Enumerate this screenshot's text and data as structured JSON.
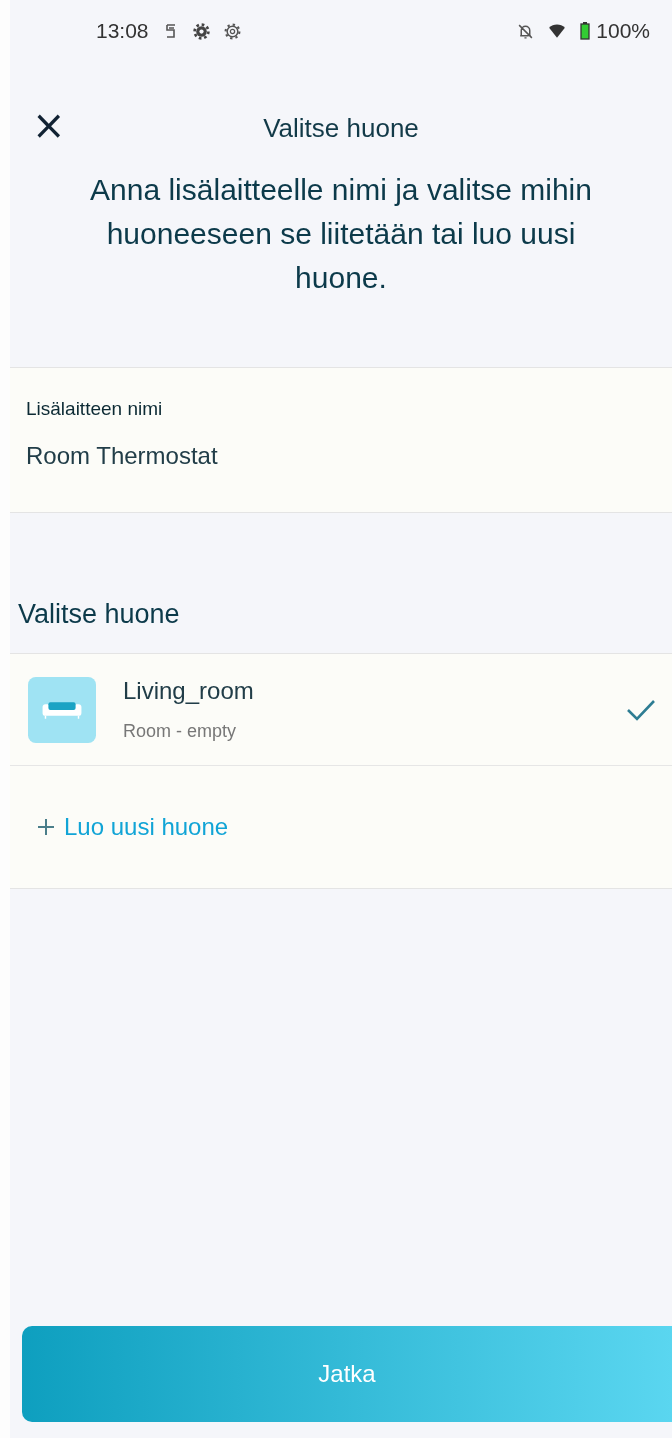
{
  "status_bar": {
    "time": "13:08",
    "battery": "100%"
  },
  "header": {
    "close": "×",
    "title": "Valitse huone",
    "instructions": "Anna lisälaitteelle nimi ja valitse mihin huoneeseen se liitetään tai luo uusi huone."
  },
  "name_field": {
    "label": "Lisälaitteen nimi",
    "value": "Room Thermostat"
  },
  "rooms_heading": "Valitse huone",
  "rooms": [
    {
      "name": "Living_room",
      "subtitle": "Room - empty",
      "selected": true
    }
  ],
  "add_room": "Luo uusi huone",
  "continue_button": "Jatka"
}
